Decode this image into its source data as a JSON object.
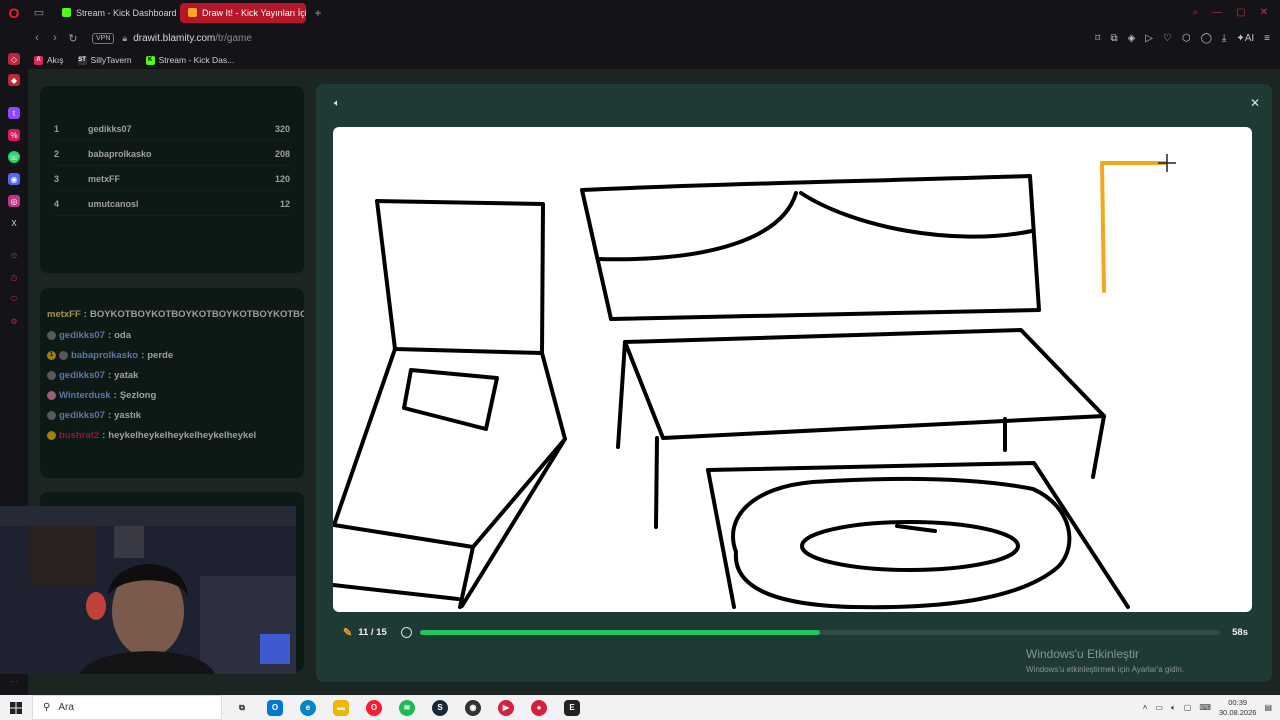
{
  "browser": {
    "tabs": [
      {
        "label": "Stream - Kick Dashboard",
        "active": false,
        "favicon_color": "#53fc18"
      },
      {
        "label": "Draw It! - Kick Yayınları İçin",
        "active": true,
        "favicon_color": "#f5a623"
      }
    ],
    "url_host": "drawit.blamity.com",
    "url_path": "/tr/game",
    "vpn_label": "VPN",
    "ai_label": "AI",
    "bookmarks": [
      {
        "label": "Akış",
        "icon_color": "#e0245e",
        "icon_text": "A"
      },
      {
        "label": "SillyTavern",
        "icon_color": "#333",
        "icon_text": "ST"
      },
      {
        "label": "Stream - Kick Das...",
        "icon_color": "#53fc18",
        "icon_text": "K"
      }
    ]
  },
  "leaderboard": [
    {
      "rank": "1",
      "name": "gedikks07",
      "score": "320"
    },
    {
      "rank": "2",
      "name": "babaprolkasko",
      "score": "208"
    },
    {
      "rank": "3",
      "name": "metxFF",
      "score": "120"
    },
    {
      "rank": "4",
      "name": "umutcanosl",
      "score": "12"
    }
  ],
  "chat": [
    {
      "user": "metxFF",
      "message": "BOYKOTBOYKOTBOYKOTBOYKOTBOYKOTBOYKOT",
      "user_color": "#f2e27a",
      "badge": ""
    },
    {
      "user": "gedikks07",
      "message": "oda",
      "user_color": "#8fb4ff",
      "badge": "grey"
    },
    {
      "user": "babaprolkasko",
      "message": "perde",
      "user_color": "#8fb4ff",
      "badge": "gold"
    },
    {
      "user": "gedikks07",
      "message": "yatak",
      "user_color": "#8fb4ff",
      "badge": "grey"
    },
    {
      "user": "Winterdusk",
      "message": "Şezlong",
      "user_color": "#8fb4ff",
      "badge": "pink"
    },
    {
      "user": "gedikks07",
      "message": "yastık",
      "user_color": "#8fb4ff",
      "badge": "grey"
    },
    {
      "user": "bushrat2",
      "message": "heykelheykelheykelheykelheykel",
      "user_color": "#e0245e",
      "badge": "gold"
    }
  ],
  "game": {
    "round": "11 / 15",
    "timer": "58s",
    "progress": 0.5,
    "ink_color": "#000000",
    "active_color": "#f0a81c"
  },
  "watermark": {
    "line1": "Windows'u Etkinleştir",
    "line2": "Windows'u etkinleştirmek için Ayarlar'a gidin."
  },
  "taskbar": {
    "search_label": "Ara",
    "time": "00:39",
    "date": "30.08.2026"
  }
}
